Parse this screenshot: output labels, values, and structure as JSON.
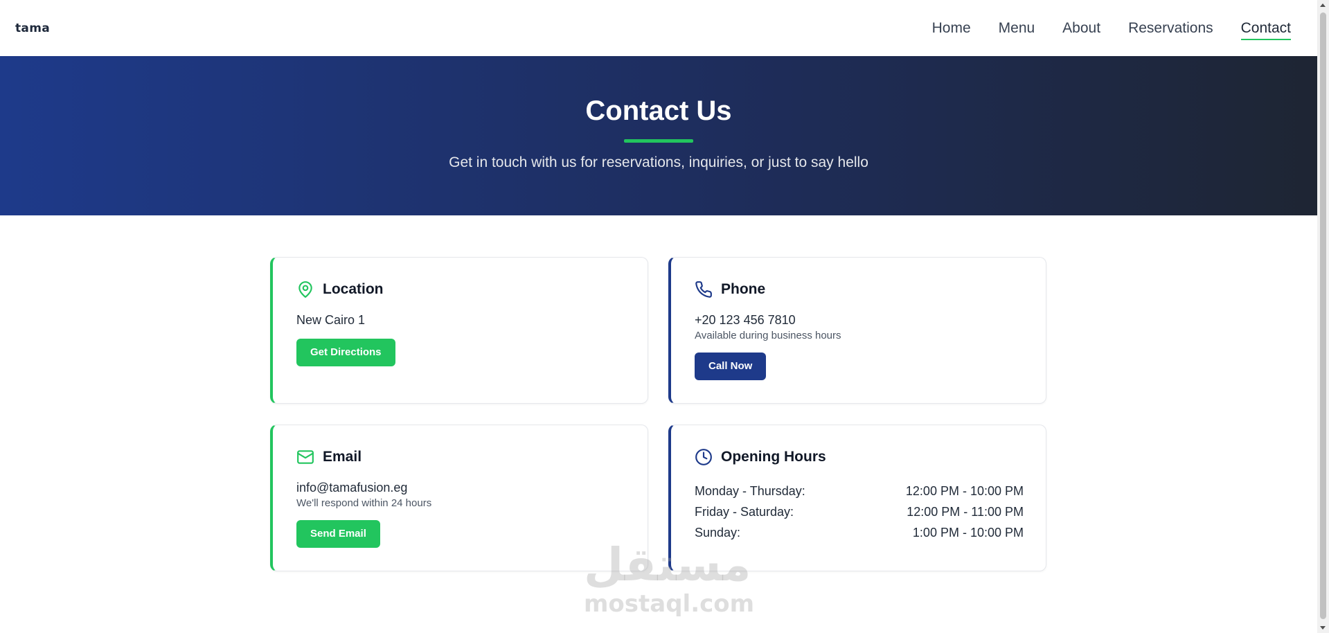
{
  "nav": {
    "logo": "tama",
    "links": [
      {
        "label": "Home"
      },
      {
        "label": "Menu"
      },
      {
        "label": "About"
      },
      {
        "label": "Reservations"
      },
      {
        "label": "Contact"
      }
    ],
    "active": "Contact"
  },
  "hero": {
    "title": "Contact Us",
    "subtitle": "Get in touch with us for reservations, inquiries, or just to say hello"
  },
  "cards": {
    "location": {
      "icon": "map-pin-icon",
      "title": "Location",
      "value": "New Cairo 1",
      "button": "Get Directions"
    },
    "phone": {
      "icon": "phone-icon",
      "title": "Phone",
      "value": "+20 123 456 7810",
      "note": "Available during business hours",
      "button": "Call Now"
    },
    "email": {
      "icon": "mail-icon",
      "title": "Email",
      "value": "info@tamafusion.eg",
      "note": "We'll respond within 24 hours",
      "button": "Send Email"
    },
    "hours": {
      "icon": "clock-icon",
      "title": "Opening Hours",
      "rows": [
        {
          "days": "Monday - Thursday:",
          "time": "12:00 PM - 10:00 PM"
        },
        {
          "days": "Friday - Saturday:",
          "time": "12:00 PM - 11:00 PM"
        },
        {
          "days": "Sunday:",
          "time": "1:00 PM - 10:00 PM"
        }
      ]
    }
  },
  "watermark": {
    "arabic": "مستقل",
    "latin": "mostaql.com"
  },
  "colors": {
    "accent_green": "#22c55e",
    "brand_blue": "#1e3a8a",
    "hero_dark": "#1e2533"
  }
}
